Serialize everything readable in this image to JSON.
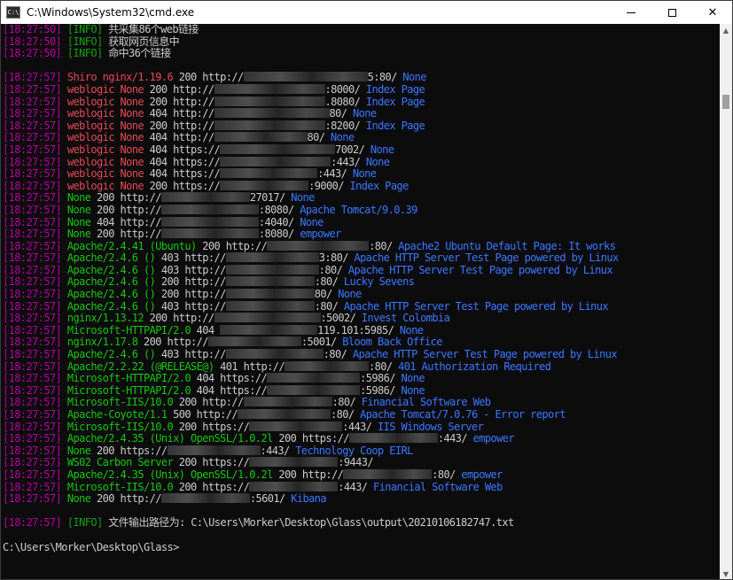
{
  "window": {
    "title": "C:\\Windows\\System32\\cmd.exe",
    "icon": "console-app-icon",
    "icon_text": "C:\\",
    "controls": {
      "minimize": "minimize-icon",
      "maximize": "maximize-icon",
      "close": "close-icon",
      "close_glyph": "✕"
    }
  },
  "console": {
    "header_lines": [
      {
        "ts": "[18:27:50]",
        "tag": "[INFO]",
        "text": " 共采集86个web链接"
      },
      {
        "ts": "[18:27:50]",
        "tag": "[INFO]",
        "text": " 获取网页信息中"
      },
      {
        "ts": "[18:27:50]",
        "tag": "[INFO]",
        "text": " 命中36个链接"
      }
    ],
    "results": [
      {
        "ts": "[18:27:57]",
        "pre": "Shiro nginx/1.19.6",
        "pre_color": "r",
        "code": "200",
        "scheme": "http://",
        "blur": 140,
        "host_tail": "5:80/",
        "title": "None"
      },
      {
        "ts": "[18:27:57]",
        "pre": "weblogic None",
        "pre_color": "r",
        "code": "200",
        "scheme": "http://",
        "blur": 125,
        "host_tail": ":8000/",
        "title": "Index Page"
      },
      {
        "ts": "[18:27:57]",
        "pre": "weblogic None",
        "pre_color": "r",
        "code": "200",
        "scheme": "http://",
        "blur": 125,
        "host_tail": ".8080/",
        "title": "Index Page"
      },
      {
        "ts": "[18:27:57]",
        "pre": "weblogic None",
        "pre_color": "r",
        "code": "404",
        "scheme": "http://",
        "blur": 130,
        "host_tail": "80/",
        "title": "None"
      },
      {
        "ts": "[18:27:57]",
        "pre": "weblogic None",
        "pre_color": "r",
        "code": "200",
        "scheme": "http://",
        "blur": 125,
        "host_tail": ":8200/",
        "title": "Index Page"
      },
      {
        "ts": "[18:27:57]",
        "pre": "weblogic None",
        "pre_color": "r",
        "code": "404",
        "scheme": "http://",
        "blur": 105,
        "host_tail": "80/",
        "title": "None"
      },
      {
        "ts": "[18:27:57]",
        "pre": "weblogic None",
        "pre_color": "r",
        "code": "404",
        "scheme": "https://",
        "blur": 130,
        "host_tail": "7002/",
        "title": "None"
      },
      {
        "ts": "[18:27:57]",
        "pre": "weblogic None",
        "pre_color": "r",
        "code": "404",
        "scheme": "https://",
        "blur": 125,
        "host_tail": ":443/",
        "title": "None"
      },
      {
        "ts": "[18:27:57]",
        "pre": "weblogic None",
        "pre_color": "r",
        "code": "404",
        "scheme": "https://",
        "blur": 110,
        "host_tail": ":443/",
        "title": "None"
      },
      {
        "ts": "[18:27:57]",
        "pre": "weblogic None",
        "pre_color": "r",
        "code": "200",
        "scheme": "https://",
        "blur": 100,
        "host_tail": ":9000/",
        "title": "Index Page"
      },
      {
        "ts": "[18:27:57]",
        "pre": "None",
        "pre_color": "g",
        "code": "200",
        "scheme": "http://",
        "blur": 100,
        "host_tail": "27017/",
        "title": "None"
      },
      {
        "ts": "[18:27:57]",
        "pre": "None",
        "pre_color": "g",
        "code": "200",
        "scheme": "http://",
        "blur": 110,
        "host_tail": ":8080/",
        "title": "Apache Tomcat/9.0.39"
      },
      {
        "ts": "[18:27:57]",
        "pre": "None",
        "pre_color": "g",
        "code": "404",
        "scheme": "http://",
        "blur": 110,
        "host_tail": ":4040/",
        "title": "None"
      },
      {
        "ts": "[18:27:57]",
        "pre": "None",
        "pre_color": "g",
        "code": "200",
        "scheme": "http://",
        "blur": 110,
        "host_tail": ":8080/",
        "title": "empower"
      },
      {
        "ts": "[18:27:57]",
        "pre": "Apache/2.4.41 (Ubuntu)",
        "pre_color": "g",
        "code": "200",
        "scheme": "http://",
        "blur": 115,
        "host_tail": ":80/",
        "title": "Apache2 Ubuntu Default Page: It works"
      },
      {
        "ts": "[18:27:57]",
        "pre": "Apache/2.4.6 ()",
        "pre_color": "g",
        "code": "403",
        "scheme": "http://",
        "blur": 105,
        "host_tail": "3:80/",
        "title": "Apache HTTP Server Test Page powered by Linux"
      },
      {
        "ts": "[18:27:57]",
        "pre": "Apache/2.4.6 ()",
        "pre_color": "g",
        "code": "403",
        "scheme": "http://",
        "blur": 105,
        "host_tail": ":80/",
        "title": "Apache HTTP Server Test Page powered by Linux"
      },
      {
        "ts": "[18:27:57]",
        "pre": "Apache/2.4.6 ()",
        "pre_color": "g",
        "code": "200",
        "scheme": "http://",
        "blur": 100,
        "host_tail": ":80/",
        "title": "Lucky Sevens"
      },
      {
        "ts": "[18:27:57]",
        "pre": "Apache/2.4.6 ()",
        "pre_color": "g",
        "code": "200",
        "scheme": "http://",
        "blur": 100,
        "host_tail": "80/",
        "title": "None"
      },
      {
        "ts": "[18:27:57]",
        "pre": "Apache/2.4.6 ()",
        "pre_color": "g",
        "code": "403",
        "scheme": "http://",
        "blur": 100,
        "host_tail": ":80/",
        "title": "Apache HTTP Server Test Page powered by Linux"
      },
      {
        "ts": "[18:27:57]",
        "pre": "nginx/1.13.12",
        "pre_color": "g",
        "code": "200",
        "scheme": "http://",
        "blur": 120,
        "host_tail": ":5002/",
        "title": "Invest Colombia"
      },
      {
        "ts": "[18:27:57]",
        "pre": "Microsoft-HTTPAPI/2.0",
        "pre_color": "g",
        "code": "404",
        "scheme": "",
        "blur": 110,
        "host_tail": "119.101:5985/",
        "title": "None"
      },
      {
        "ts": "[18:27:57]",
        "pre": "nginx/1.17.8",
        "pre_color": "g",
        "code": "200",
        "scheme": "http://",
        "blur": 105,
        "host_tail": ":5001/",
        "title": "Bloom Back Office"
      },
      {
        "ts": "[18:27:57]",
        "pre": "Apache/2.4.6 ()",
        "pre_color": "g",
        "code": "403",
        "scheme": "http://",
        "blur": 110,
        "host_tail": ":80/",
        "title": "Apache HTTP Server Test Page powered by Linux"
      },
      {
        "ts": "[18:27:57]",
        "pre": "Apache/2.2.22 (@RELEASE@)",
        "pre_color": "g",
        "code": "401",
        "scheme": "http://",
        "blur": 95,
        "host_tail": ":80/",
        "title": "401 Authorization Required"
      },
      {
        "ts": "[18:27:57]",
        "pre": "Microsoft-HTTPAPI/2.0",
        "pre_color": "g",
        "code": "404",
        "scheme": "https://",
        "blur": 105,
        "host_tail": ":5986/",
        "title": "None"
      },
      {
        "ts": "[18:27:57]",
        "pre": "Microsoft-HTTPAPI/2.0",
        "pre_color": "g",
        "code": "404",
        "scheme": "https://",
        "blur": 105,
        "host_tail": ":5986/",
        "title": "None"
      },
      {
        "ts": "[18:27:57]",
        "pre": "Microsoft-IIS/10.0",
        "pre_color": "g",
        "code": "200",
        "scheme": "http://",
        "blur": 100,
        "host_tail": ":80/",
        "title": "Financial Software Web"
      },
      {
        "ts": "[18:27:57]",
        "pre": "Apache-Coyote/1.1",
        "pre_color": "g",
        "code": "500",
        "scheme": "http://",
        "blur": 105,
        "host_tail": ":80/",
        "title": "Apache Tomcat/7.0.76 - Error report"
      },
      {
        "ts": "[18:27:57]",
        "pre": "Microsoft-IIS/10.0",
        "pre_color": "g",
        "code": "200",
        "scheme": "https://",
        "blur": 105,
        "host_tail": ":443/",
        "title": "IIS Windows Server"
      },
      {
        "ts": "[18:27:57]",
        "pre": "Apache/2.4.35 (Unix) OpenSSL/1.0.2l",
        "pre_color": "g",
        "code": "200",
        "scheme": "https://",
        "blur": 100,
        "host_tail": ":443/",
        "title": "empower"
      },
      {
        "ts": "[18:27:57]",
        "pre": "None",
        "pre_color": "g",
        "code": "200",
        "scheme": "https://",
        "blur": 105,
        "host_tail": ":443/",
        "title": "Technology Coop EIRL"
      },
      {
        "ts": "[18:27:57]",
        "pre": "WS02 Carbon Server",
        "pre_color": "g",
        "code": "200",
        "scheme": "https://",
        "blur": 100,
        "host_tail": ":9443/",
        "title": ""
      },
      {
        "ts": "[18:27:57]",
        "pre": "Apache/2.4.35 (Unix) OpenSSL/1.0.2l",
        "pre_color": "g",
        "code": "200",
        "scheme": "http://",
        "blur": 100,
        "host_tail": ":80/",
        "title": "empower"
      },
      {
        "ts": "[18:27:57]",
        "pre": "Microsoft-IIS/10.0",
        "pre_color": "g",
        "code": "200",
        "scheme": "https://",
        "blur": 100,
        "host_tail": ":443/",
        "title": "Financial Software Web"
      },
      {
        "ts": "[18:27:57]",
        "pre": "None",
        "pre_color": "g",
        "code": "200",
        "scheme": "http://",
        "blur": 100,
        "host_tail": ":5601/",
        "title": "Kibana"
      }
    ],
    "footer_line": {
      "ts": "[18:27:57]",
      "tag": "[INFO]",
      "text": " 文件输出路径为: C:\\Users\\Morker\\Desktop\\Glass\\output\\20210106182747.txt"
    },
    "prompt": "C:\\Users\\Morker\\Desktop\\Glass>"
  },
  "colors": {
    "background": "#0c0c0c",
    "timestamp": "#b4009e",
    "info_tag": "#13a10e",
    "red_fingerprint": "#e74856",
    "green_fingerprint": "#16c60c",
    "title_blue": "#3b78ff"
  }
}
